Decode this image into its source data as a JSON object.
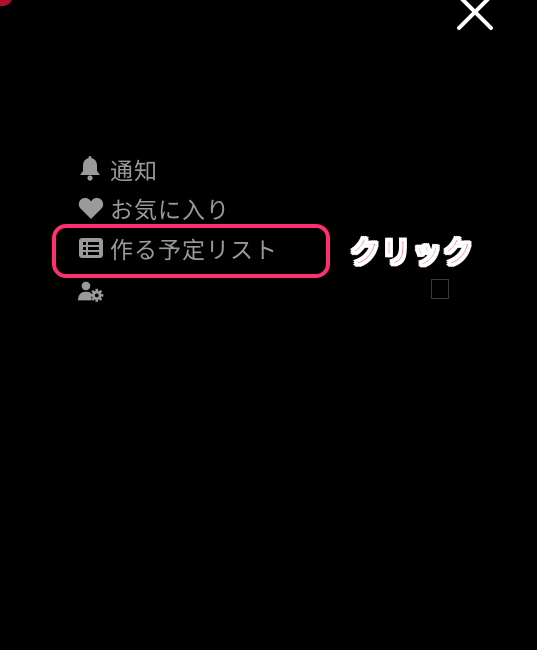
{
  "menu": {
    "items": [
      {
        "id": "notify",
        "icon": "bell-icon",
        "label": "通知"
      },
      {
        "id": "favorites",
        "icon": "heart-icon",
        "label": "お気に入り"
      },
      {
        "id": "schedule-list",
        "icon": "list-icon",
        "label": "作る予定リスト"
      },
      {
        "id": "user-settings",
        "icon": "user-settings-icon",
        "label": ""
      }
    ]
  },
  "annotation": {
    "text": "クリック",
    "color": "#ff3c7d"
  },
  "colors": {
    "background": "#000000",
    "menu_text": "#9a9a9a",
    "highlight": "#ff2f72",
    "close_icon": "#ffffff"
  }
}
